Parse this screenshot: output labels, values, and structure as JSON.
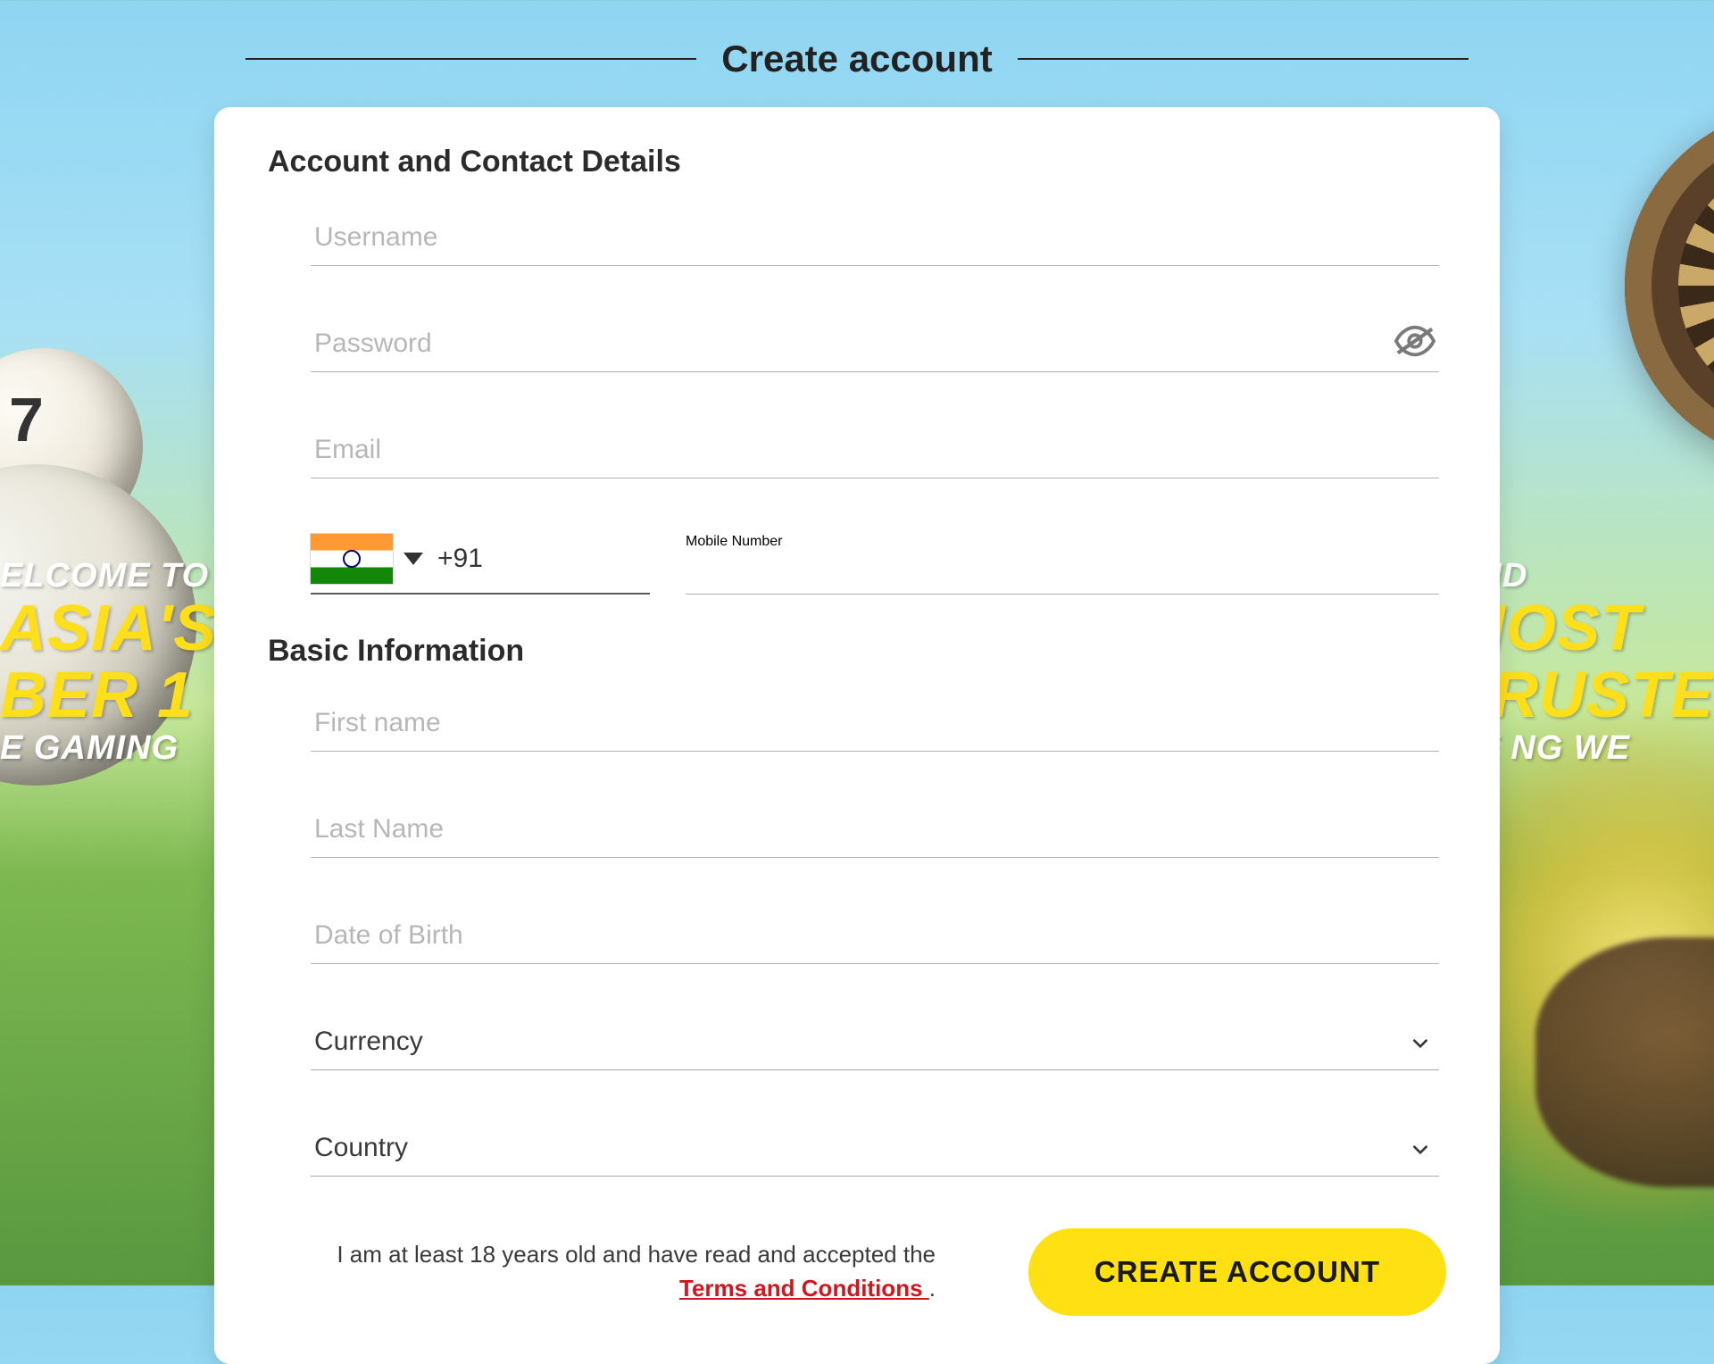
{
  "page_title": "Create account",
  "bg": {
    "left": {
      "l1": "ELCOME TO",
      "l2": "ASIA'S",
      "l3": "BER 1",
      "l4": "E GAMING"
    },
    "right": {
      "r1": "AND",
      "r2": "MOST",
      "r3": "TRUSTE",
      "r4": "BE      NG WE"
    }
  },
  "form": {
    "section1_title": "Account and Contact Details",
    "username_placeholder": "Username",
    "password_placeholder": "Password",
    "email_placeholder": "Email",
    "country_code": "+91",
    "mobile_placeholder": "Mobile Number",
    "section2_title": "Basic Information",
    "firstname_placeholder": "First name",
    "lastname_placeholder": "Last Name",
    "dob_placeholder": "Date of Birth",
    "currency_label": "Currency",
    "country_label": "Country"
  },
  "agreement": {
    "text_before": "I am at least 18 years old and have read and accepted the ",
    "link": "Terms and Conditions ",
    "text_after": "."
  },
  "submit_label": "CREATE ACCOUNT"
}
